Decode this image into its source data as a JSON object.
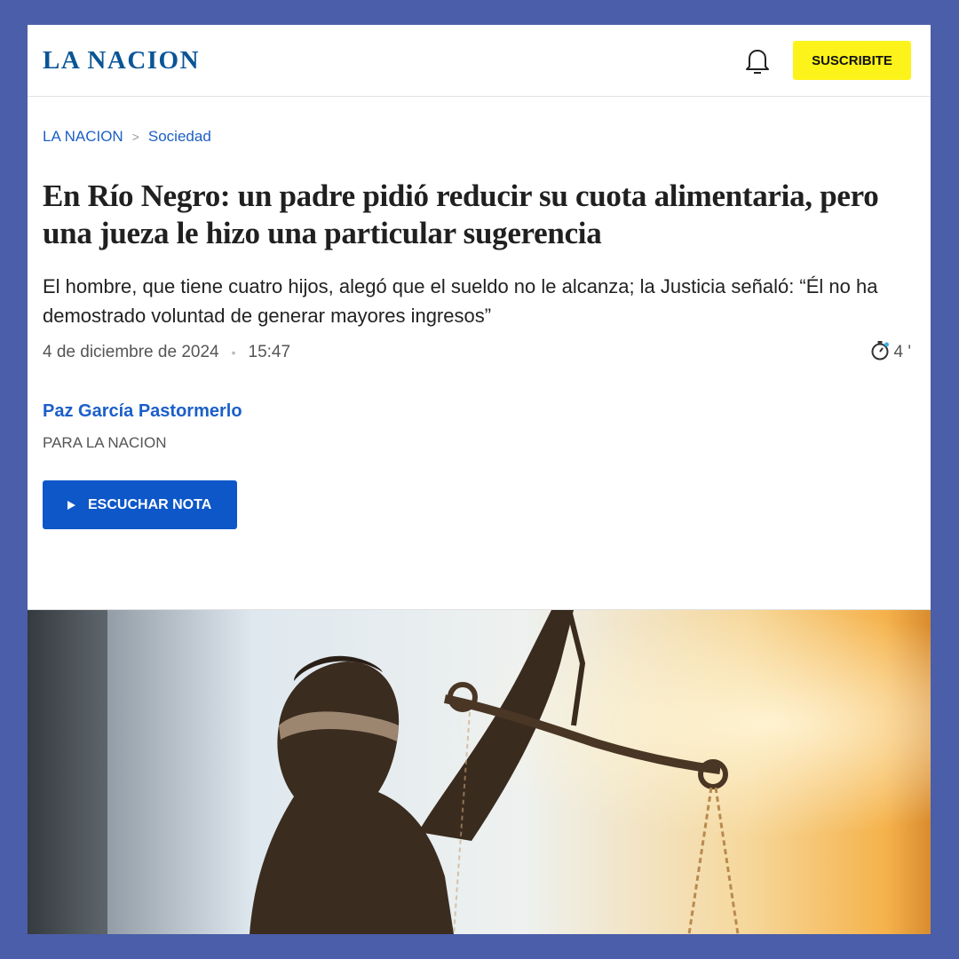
{
  "header": {
    "logo": "LA NACION",
    "subscribe_label": "SUSCRIBITE"
  },
  "breadcrumb": {
    "home": "LA NACION",
    "separator": ">",
    "section": "Sociedad"
  },
  "article": {
    "headline": "En Río Negro: un padre pidió reducir su cuota alimentaria, pero una jueza le hizo una particular sugerencia",
    "subhead": "El hombre, que tiene cuatro hijos, alegó que el sueldo no le alcanza; la Justicia señaló: “Él no ha demostrado voluntad de generar mayores ingresos”",
    "date": "4 de diciembre de 2024",
    "time": "15:47",
    "read_time": "4 '",
    "author": "Paz García Pastormerlo",
    "affiliation": "PARA LA NACION",
    "listen_label": "ESCUCHAR NOTA"
  },
  "colors": {
    "brand": "#0a5596",
    "subscribe_bg": "#fcf31a",
    "link": "#1d5fc4",
    "listen_bg": "#0e57c9",
    "page_bg": "#4a5ea9"
  }
}
